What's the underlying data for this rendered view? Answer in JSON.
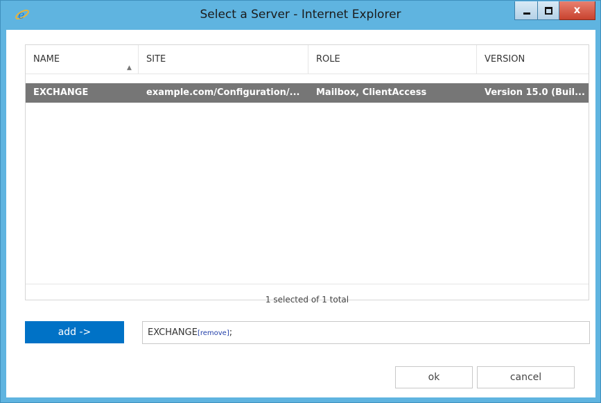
{
  "window": {
    "title": "Select a Server - Internet Explorer",
    "close_label": "x"
  },
  "grid": {
    "columns": [
      {
        "label": "NAME"
      },
      {
        "label": "SITE"
      },
      {
        "label": "ROLE"
      },
      {
        "label": "VERSION"
      }
    ],
    "sort_icon": "▲",
    "rows": [
      {
        "name": "EXCHANGE",
        "site": "example.com/Configuration/...",
        "role": "Mailbox, ClientAccess",
        "version": "Version 15.0 (Buil..."
      }
    ],
    "status": "1 selected of 1 total"
  },
  "picker": {
    "add_label": "add ->",
    "selected_name": "EXCHANGE",
    "remove_label": "[remove]",
    "separator": ";"
  },
  "buttons": {
    "ok": "ok",
    "cancel": "cancel"
  },
  "colors": {
    "accent": "#0072c6",
    "selected_row": "#767676",
    "titlebar": "#5fb4e0"
  }
}
